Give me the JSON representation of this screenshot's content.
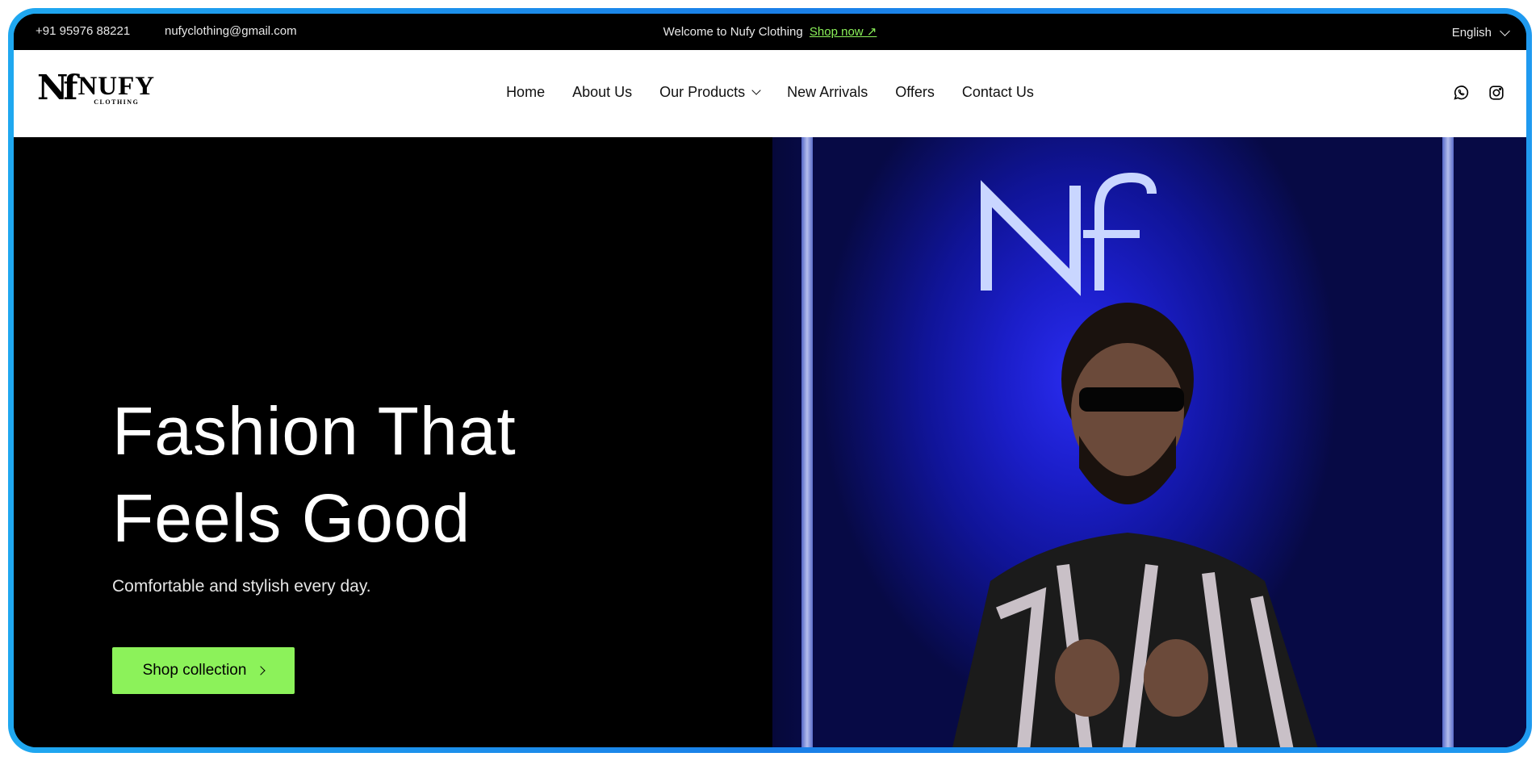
{
  "topbar": {
    "phone": "+91 95976 88221",
    "email": "nufyclothing@gmail.com",
    "welcome": "Welcome to Nufy Clothing",
    "shop_link": "Shop now ↗",
    "language": "English"
  },
  "logo": {
    "mark": "Nf",
    "brand": "NUFY",
    "sub": "CLOTHING"
  },
  "nav": {
    "items": [
      {
        "label": "Home"
      },
      {
        "label": "About Us"
      },
      {
        "label": "Our Products"
      },
      {
        "label": "New Arrivals"
      },
      {
        "label": "Offers"
      },
      {
        "label": "Contact Us"
      }
    ]
  },
  "social": {
    "icons": [
      "whatsapp-icon",
      "instagram-icon"
    ]
  },
  "hero": {
    "title_line1": "Fashion That",
    "title_line2": "Feels Good",
    "subtitle": "Comfortable and stylish every day.",
    "cta": "Shop collection"
  },
  "colors": {
    "accent": "#8cf25a",
    "frame": "#1a7fe8",
    "background": "#000000"
  }
}
